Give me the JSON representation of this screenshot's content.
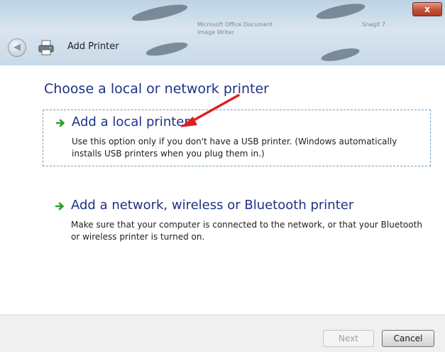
{
  "window": {
    "title": "Add Printer",
    "close_label": "x"
  },
  "background_text": {
    "ghost_1": "Microsoft Office Document",
    "ghost_2": "Image Writer",
    "ghost_3": "Snagit 7"
  },
  "main": {
    "heading": "Choose a local or network printer",
    "options": [
      {
        "title": "Add a local printer",
        "description": "Use this option only if you don't have a USB printer. (Windows automatically installs USB printers when you plug them in.)"
      },
      {
        "title": "Add a network, wireless or Bluetooth printer",
        "description": "Make sure that your computer is connected to the network, or that your Bluetooth or wireless printer is turned on."
      }
    ]
  },
  "footer": {
    "next_label": "Next",
    "cancel_label": "Cancel"
  },
  "icons": {
    "back": "back-arrow-icon",
    "printer": "printer-icon",
    "option": "green-arrow-icon",
    "annotation": "red-arrow-icon"
  },
  "colors": {
    "heading": "#1e3287",
    "option_arrow": "#2aa02a",
    "annotation_arrow": "#e02020",
    "close_button": "#c8553c"
  }
}
